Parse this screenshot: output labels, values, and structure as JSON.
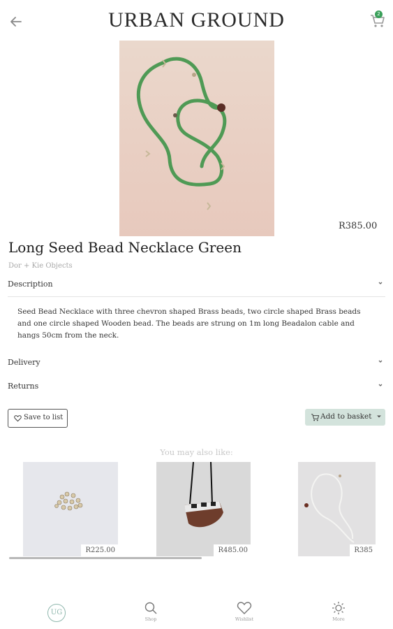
{
  "header": {
    "brand": "URBAN GROUND",
    "back_icon": "arrow-left-icon",
    "cart_icon": "cart-icon",
    "cart_count": "2",
    "accent_color": "#3aa05a"
  },
  "product": {
    "price": "R385.00",
    "name": "Long Seed Bead Necklace Green",
    "vendor": "Dor + Kie Objects"
  },
  "sections": {
    "description_label": "Description",
    "description_text": "Seed Bead Necklace with three chevron shaped Brass beads, two circle shaped Brass beads and one circle shaped Wooden bead. The beads are strung on 1m long Beadalon cable and hangs 50cm from the neck.",
    "delivery_label": "Delivery",
    "returns_label": "Returns"
  },
  "actions": {
    "save_label": "Save to list",
    "basket_label": "Add to basket",
    "basket_color": "#d3e3dc"
  },
  "recommendations": {
    "heading": "You may also like:",
    "items": [
      {
        "price": "R225.00"
      },
      {
        "price": "R485.00"
      },
      {
        "price": "R385"
      }
    ]
  },
  "bottom_nav": {
    "home_logo": "UG",
    "items": [
      {
        "label": "Shop",
        "icon": "search-icon"
      },
      {
        "label": "Wishlist",
        "icon": "heart-icon"
      },
      {
        "label": "More",
        "icon": "sun-icon"
      }
    ]
  }
}
